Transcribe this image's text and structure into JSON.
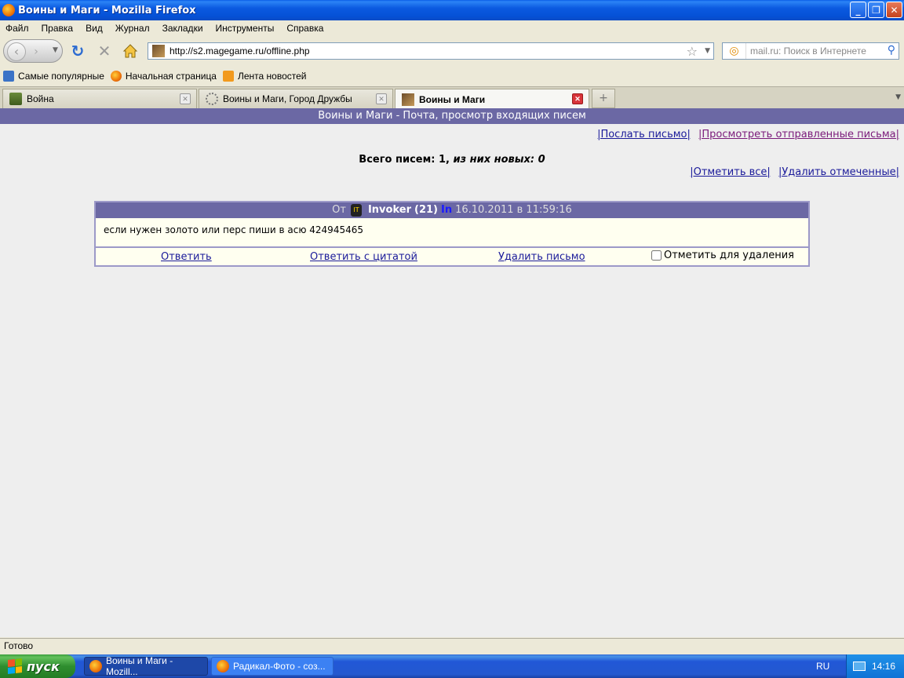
{
  "window": {
    "title": "Воины и Маги - Mozilla Firefox",
    "minimize": "_",
    "maximize": "❐",
    "close": "✕"
  },
  "menu": [
    "Файл",
    "Правка",
    "Вид",
    "Журнал",
    "Закладки",
    "Инструменты",
    "Справка"
  ],
  "nav": {
    "url": "http://s2.magegame.ru/offline.php",
    "search_placeholder": "mail.ru: Поиск в Интернете"
  },
  "bookmarks": [
    "Самые популярные",
    "Начальная страница",
    "Лента новостей"
  ],
  "tabs": [
    {
      "label": "Война",
      "active": false
    },
    {
      "label": "Воины и Маги, Город Дружбы",
      "active": false
    },
    {
      "label": "Воины и Маги",
      "active": true
    }
  ],
  "page": {
    "header": "Воины и Маги - Почта, просмотр входящих писем",
    "send_link": "|Послать письмо|",
    "sent_link": "|Просмотреть отправленные письма|",
    "total_label": "Всего писем: 1, ",
    "total_new": "из них новых: 0",
    "mark_all": "|Отметить все|",
    "delete_marked": "|Удалить отмеченные|"
  },
  "message": {
    "from_label": "От",
    "avatar_text": "IT",
    "sender": "Invoker",
    "level": "(21)",
    "online": "In",
    "date": "16.10.2011 в 11:59:16",
    "body": "если нужен золото или перс пиши в асю 424945465",
    "reply": "Ответить",
    "reply_quote": "Ответить с цитатой",
    "delete": "Удалить письмо",
    "mark_delete": "Отметить для удаления"
  },
  "status": "Готово",
  "taskbar": {
    "start": "пуск",
    "tasks": [
      {
        "label": "Воины и Маги - Mozill...",
        "active": true
      },
      {
        "label": "Радикал-Фото - соз...",
        "active": false
      }
    ],
    "lang": "RU",
    "time": "14:16"
  }
}
